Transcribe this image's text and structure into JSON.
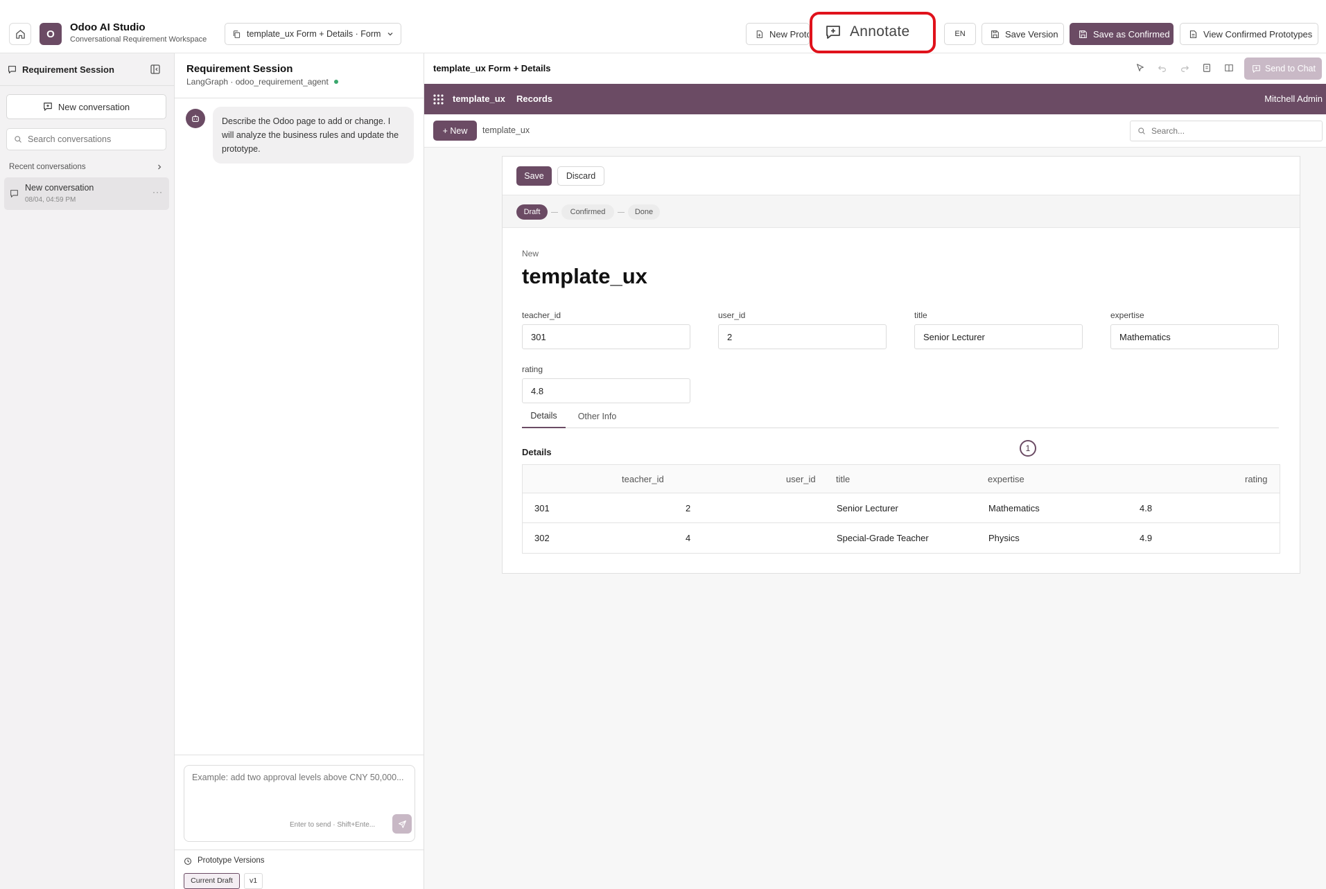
{
  "app": {
    "logo_letter": "O",
    "title": "Odoo AI Studio",
    "subtitle": "Conversational Requirement Workspace",
    "page_selector": "template_ux Form + Details · Form"
  },
  "toolbar": {
    "new_prototype": "New Proto",
    "annotate": "Annotate",
    "lang": "EN",
    "save_version": "Save Version",
    "save_confirmed": "Save as Confirmed",
    "view_confirmed": "View Confirmed Prototypes"
  },
  "sidebar": {
    "title": "Requirement Session",
    "new_conversation": "New conversation",
    "search_placeholder": "Search conversations",
    "recent_label": "Recent conversations",
    "conversations": [
      {
        "title": "New conversation",
        "time": "08/04, 04:59 PM"
      }
    ]
  },
  "chat": {
    "title": "Requirement Session",
    "subtitle": "LangGraph · odoo_requirement_agent",
    "message": "Describe the Odoo page to add or change. I will analyze the business rules and update the prototype.",
    "input_placeholder": "Example: add two approval levels above CNY 50,000...",
    "hint": "Enter to send · Shift+Ente...",
    "versions_label": "Prototype Versions",
    "versions": [
      "Current Draft",
      "v1"
    ]
  },
  "preview": {
    "title": "template_ux Form + Details",
    "send_to_chat": "Send to Chat",
    "navbar": {
      "app": "template_ux",
      "menu": "Records",
      "user": "Mitchell Admin"
    },
    "control": {
      "new_button": "+ New",
      "breadcrumb": "template_ux",
      "search_placeholder": "Search..."
    },
    "form": {
      "save": "Save",
      "discard": "Discard",
      "statuses": [
        "Draft",
        "Confirmed",
        "Done"
      ],
      "record_state": "New",
      "record_title": "template_ux",
      "fields": [
        {
          "label": "teacher_id",
          "value": "301"
        },
        {
          "label": "user_id",
          "value": "2"
        },
        {
          "label": "title",
          "value": "Senior Lecturer"
        },
        {
          "label": "expertise",
          "value": "Mathematics"
        },
        {
          "label": "rating",
          "value": "4.8"
        }
      ],
      "tabs": [
        "Details",
        "Other Info"
      ],
      "annotation_marker": "1",
      "details_heading": "Details",
      "table": {
        "headers": [
          "teacher_id",
          "user_id",
          "title",
          "expertise",
          "rating"
        ],
        "rows": [
          [
            "301",
            "2",
            "Senior Lecturer",
            "Mathematics",
            "4.8"
          ],
          [
            "302",
            "4",
            "Special-Grade Teacher",
            "Physics",
            "4.9"
          ]
        ]
      }
    }
  },
  "colors": {
    "brand": "#6b4b64",
    "highlight": "#e0121b"
  }
}
